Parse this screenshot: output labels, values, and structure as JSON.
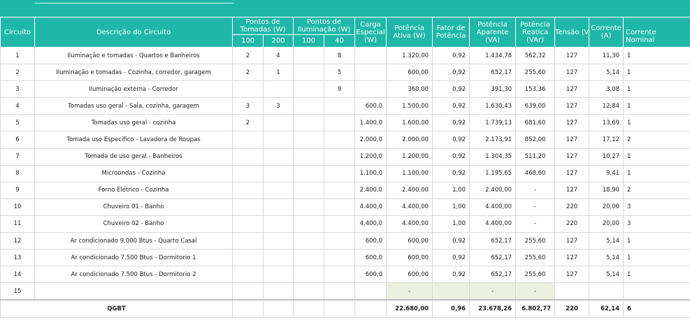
{
  "header": {
    "circuito": "Circuito",
    "descricao": "Descrição do Circuito",
    "pontos_tomadas": "Pontos de\nTomadas (W)",
    "pontos_iluminacao": "Pontos de\nIluminação (W)",
    "tomadas_100": "100",
    "tomadas_200": "200",
    "ilum_100": "100",
    "ilum_40": "40",
    "carga_especial": "Carga\nEspecial\n(W)",
    "potencia_ativa": "Potência\nAtiva (W)",
    "fator_potencia": "Fator de\nPotência",
    "potencia_aparente": "Potência\nAparente\n(VA)",
    "potencia_reativa": "Potência\nReatica\n(VAr)",
    "tensao": "Tensão (V)",
    "corrente": "Corrente\n(A)",
    "corrente_nominal": "Corrente\nNominal"
  },
  "rows": [
    {
      "circuito": "1",
      "descricao": "Iluminação e tomadas -  Quartos e Banheiros",
      "t100": "2",
      "t200": "4",
      "i100": "",
      "i40": "8",
      "carga": "",
      "pativa": "1.320,00",
      "fp": "0,92",
      "paparente": "1.434,78",
      "preativa": "562,32",
      "tensao": "127",
      "corrente": "11,30",
      "nominal": "1"
    },
    {
      "circuito": "2",
      "descricao": "Iluminação e tomadas - Cozinha, corredor, garagem",
      "t100": "2",
      "t200": "1",
      "i100": "",
      "i40": "5",
      "carga": "",
      "pativa": "600,00",
      "fp": "0,92",
      "paparente": "652,17",
      "preativa": "255,60",
      "tensao": "127",
      "corrente": "5,14",
      "nominal": "1"
    },
    {
      "circuito": "3",
      "descricao": "Iluminação externa - Corredor",
      "t100": "",
      "t200": "",
      "i100": "",
      "i40": "9",
      "carga": "",
      "pativa": "360,00",
      "fp": "0,92",
      "paparente": "391,30",
      "preativa": "153,36",
      "tensao": "127",
      "corrente": "3,08",
      "nominal": "1"
    },
    {
      "circuito": "4",
      "descricao": "Tomadas uso geral - Sala, cozinha, garagem",
      "t100": "3",
      "t200": "3",
      "i100": "",
      "i40": "",
      "carga": "600,0",
      "pativa": "1.500,00",
      "fp": "0,92",
      "paparente": "1.630,43",
      "preativa": "639,00",
      "tensao": "127",
      "corrente": "12,84",
      "nominal": "1"
    },
    {
      "circuito": "5",
      "descricao": "Tomadas uso geral - cozinha",
      "t100": "2",
      "t200": "",
      "i100": "",
      "i40": "",
      "carga": "1.400,0",
      "pativa": "1.600,00",
      "fp": "0,92",
      "paparente": "1.739,13",
      "preativa": "681,60",
      "tensao": "127",
      "corrente": "13,69",
      "nominal": "1"
    },
    {
      "circuito": "6",
      "descricao": "Tomada uso Específico - Lavadora de Roupas",
      "t100": "",
      "t200": "",
      "i100": "",
      "i40": "",
      "carga": "2.000,0",
      "pativa": "2.000,00",
      "fp": "0,92",
      "paparente": "2.173,91",
      "preativa": "852,00",
      "tensao": "127",
      "corrente": "17,12",
      "nominal": "2"
    },
    {
      "circuito": "7",
      "descricao": "Tomada de uso geral - Banheiros",
      "t100": "",
      "t200": "",
      "i100": "",
      "i40": "",
      "carga": "1.200,0",
      "pativa": "1.200,00",
      "fp": "0,92",
      "paparente": "1.304,35",
      "preativa": "511,20",
      "tensao": "127",
      "corrente": "10,27",
      "nominal": "1"
    },
    {
      "circuito": "8",
      "descricao": "Microondas - Cozinha",
      "t100": "",
      "t200": "",
      "i100": "",
      "i40": "",
      "carga": "1.100,0",
      "pativa": "1.100,00",
      "fp": "0,92",
      "paparente": "1.195,65",
      "preativa": "468,60",
      "tensao": "127",
      "corrente": "9,41",
      "nominal": "1"
    },
    {
      "circuito": "9",
      "descricao": "Forno Elétrico - Cozinha",
      "t100": "",
      "t200": "",
      "i100": "",
      "i40": "",
      "carga": "2.400,0",
      "pativa": "2.400,00",
      "fp": "1,00",
      "paparente": "2.400,00",
      "preativa": "-",
      "tensao": "127",
      "corrente": "18,90",
      "nominal": "2"
    },
    {
      "circuito": "10",
      "descricao": "Chuveiro 01 - Banho",
      "t100": "",
      "t200": "",
      "i100": "",
      "i40": "",
      "carga": "4.400,0",
      "pativa": "4.400,00",
      "fp": "1,00",
      "paparente": "4.400,00",
      "preativa": "-",
      "tensao": "220",
      "corrente": "20,00",
      "nominal": "3"
    },
    {
      "circuito": "11",
      "descricao": "Chuveiro 02 -  Banho",
      "t100": "",
      "t200": "",
      "i100": "",
      "i40": "",
      "carga": "4.400,0",
      "pativa": "4.400,00",
      "fp": "1,00",
      "paparente": "4.400,00",
      "preativa": "-",
      "tensao": "220",
      "corrente": "20,00",
      "nominal": "3"
    },
    {
      "circuito": "12",
      "descricao": "Ar condicionado 9.000 Btus - Quarto Casal",
      "t100": "",
      "t200": "",
      "i100": "",
      "i40": "",
      "carga": "600,0",
      "pativa": "600,00",
      "fp": "0,92",
      "paparente": "652,17",
      "preativa": "255,60",
      "tensao": "127",
      "corrente": "5,14",
      "nominal": "1"
    },
    {
      "circuito": "13",
      "descricao": "Ar condicionado 7.500 Btus - Dormitorio 1",
      "t100": "",
      "t200": "",
      "i100": "",
      "i40": "",
      "carga": "600,0",
      "pativa": "600,00",
      "fp": "0,92",
      "paparente": "652,17",
      "preativa": "255,60",
      "tensao": "127",
      "corrente": "5,14",
      "nominal": "1"
    },
    {
      "circuito": "14",
      "descricao": "Ar condicionado 7.500 Btus - Dormitorio 2",
      "t100": "",
      "t200": "",
      "i100": "",
      "i40": "",
      "carga": "600,0",
      "pativa": "600,00",
      "fp": "0,92",
      "paparente": "652,17",
      "preativa": "255,60",
      "tensao": "127",
      "corrente": "5,14",
      "nominal": "1"
    },
    {
      "circuito": "15",
      "descricao": "",
      "t100": "",
      "t200": "",
      "i100": "",
      "i40": "",
      "carga": "",
      "pativa": "-",
      "fp": "",
      "paparente": "-",
      "preativa": "-",
      "tensao": "",
      "corrente": "",
      "nominal": ""
    }
  ],
  "total": {
    "label": "QGBT",
    "pativa": "22.680,00",
    "fp": "0,96",
    "paparente": "23.678,26",
    "preativa": "6.802,77",
    "tensao": "220",
    "corrente": "62,14",
    "nominal": "6"
  },
  "colors": {
    "header_bg": "#1fb8a8",
    "shaded_cell": "#ebf0df"
  }
}
